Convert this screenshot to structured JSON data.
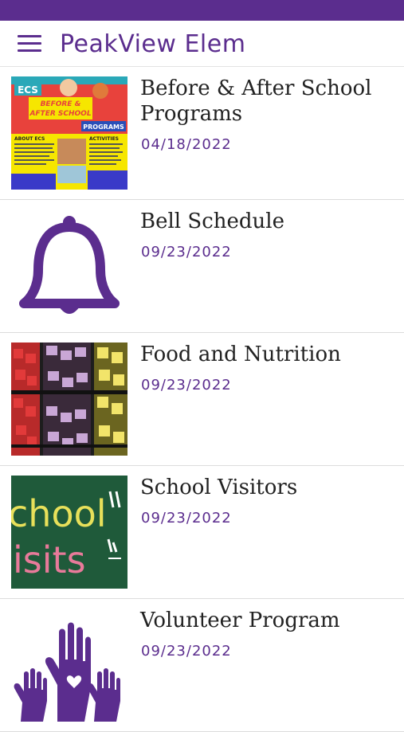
{
  "app": {
    "title": "PeakView Elem"
  },
  "items": [
    {
      "title": "Before & After School Programs",
      "date": "04/18/2022",
      "icon": "ecs-programs-flyer"
    },
    {
      "title": "Bell Schedule",
      "date": "09/23/2022",
      "icon": "bell-icon"
    },
    {
      "title": "Food and Nutrition",
      "date": "09/23/2022",
      "icon": "produce-photo"
    },
    {
      "title": "School Visitors",
      "date": "09/23/2022",
      "icon": "chalkboard-photo"
    },
    {
      "title": "Volunteer Program",
      "date": "09/23/2022",
      "icon": "raised-hands-icon"
    }
  ],
  "flyer": {
    "badge": "ECS",
    "headline_1": "BEFORE &",
    "headline_2": "AFTER SCHOOL",
    "programs": "PROGRAMS",
    "about": "ABOUT ECS",
    "activities": "ACTIVITIES"
  },
  "chalkboard": {
    "line1": "chool",
    "line2": "isits"
  },
  "colors": {
    "accent": "#5b2d8e",
    "divider": "#dcdcdc"
  }
}
